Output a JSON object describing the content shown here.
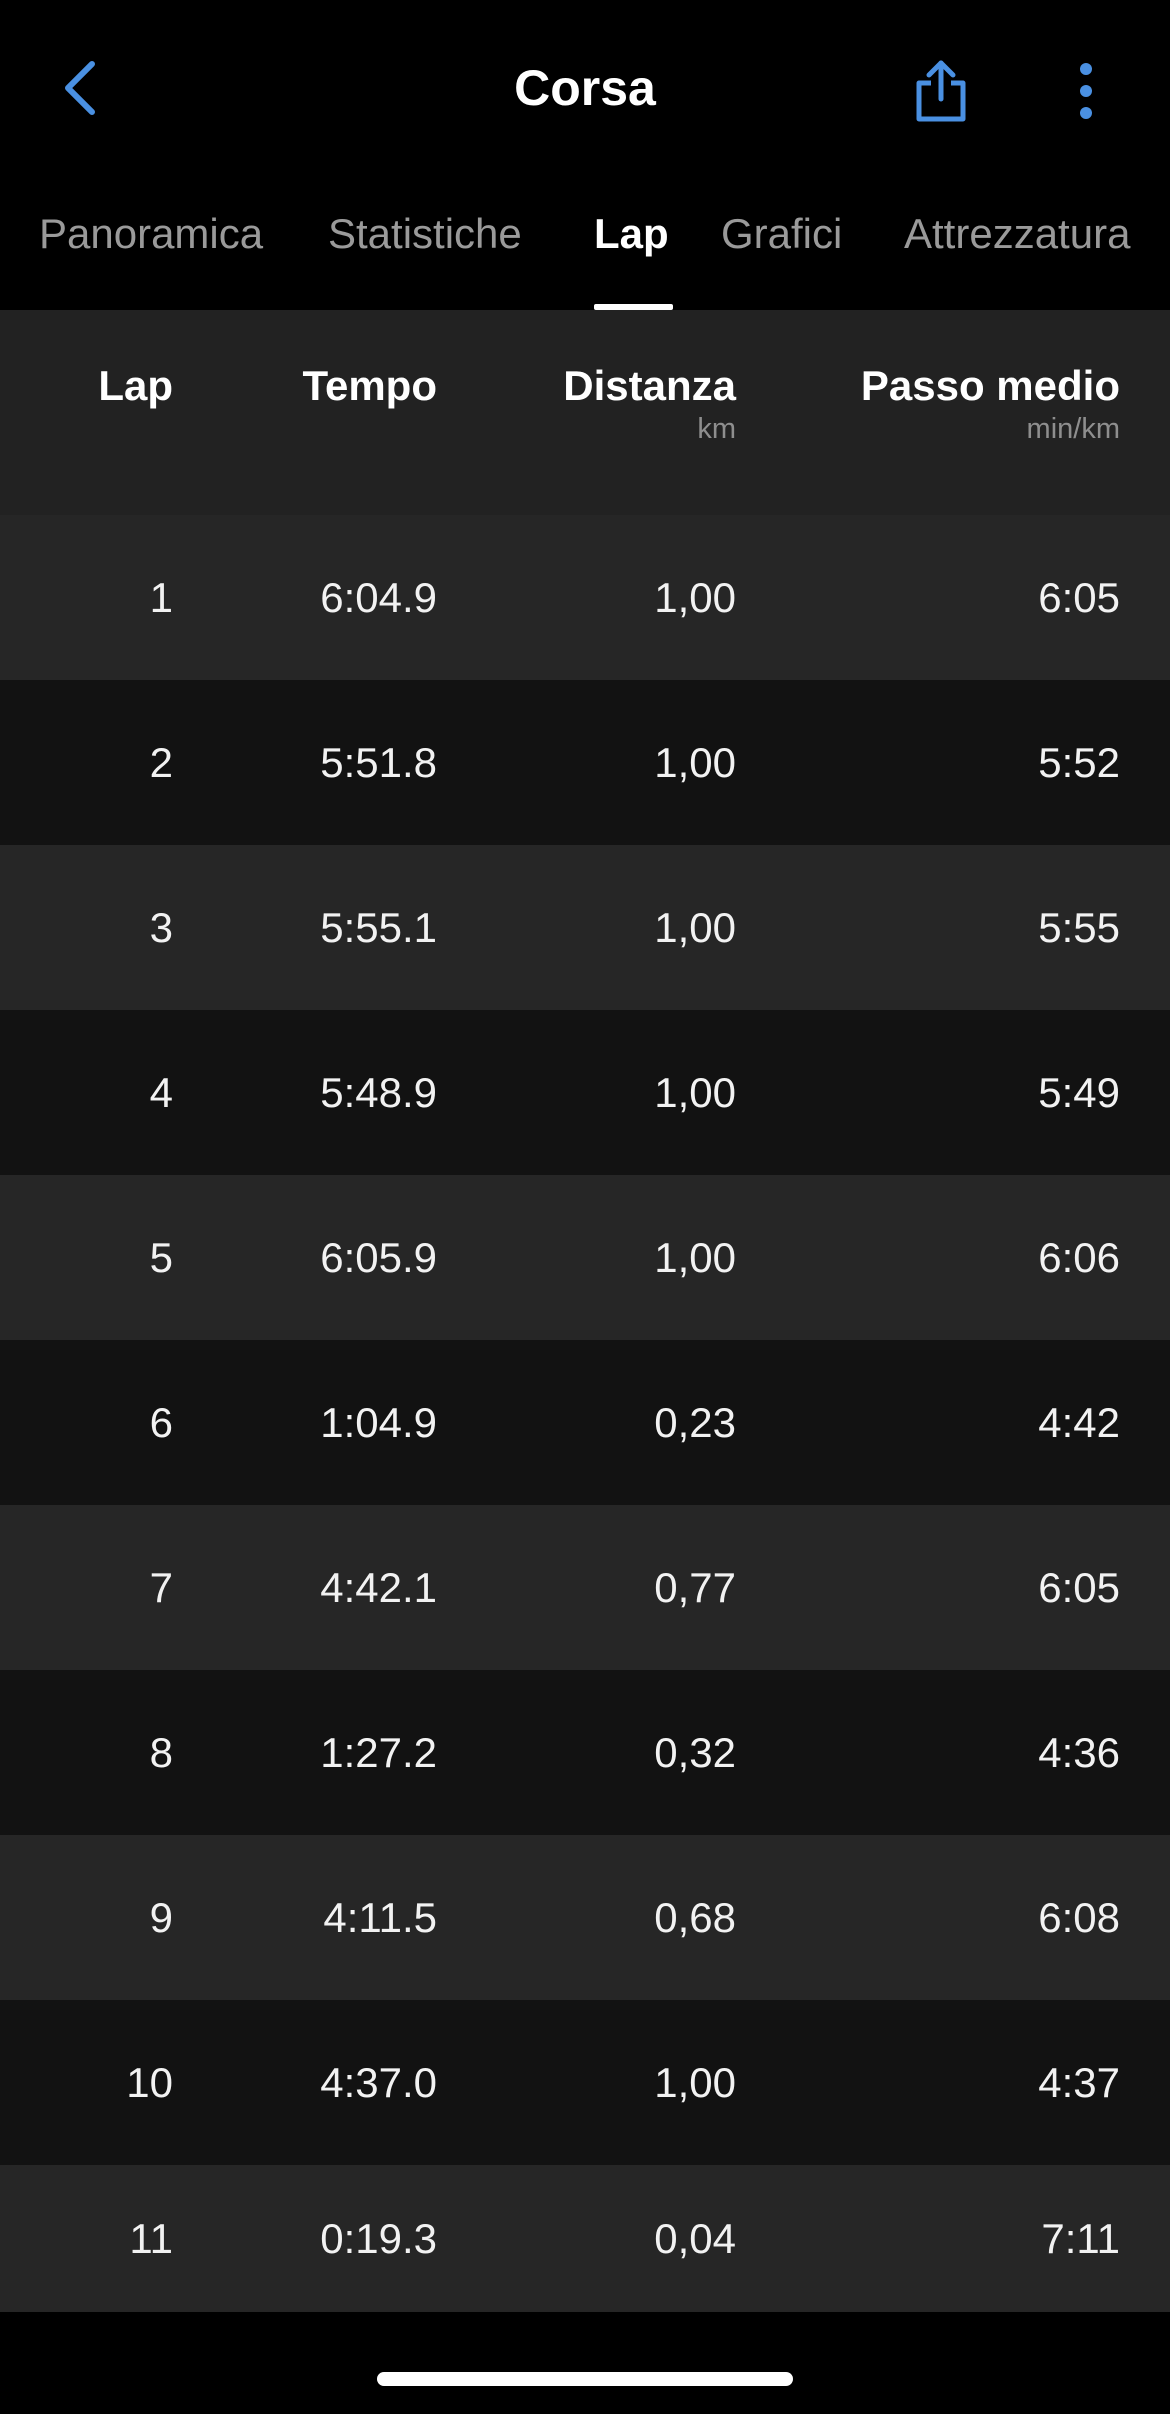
{
  "header": {
    "title": "Corsa",
    "back_icon": "chevron-left-icon",
    "share_icon": "share-icon",
    "more_icon": "more-vertical-icon",
    "accent_color": "#4a90e2"
  },
  "tabs": [
    {
      "label": "Panoramica",
      "active": false
    },
    {
      "label": "Statistiche",
      "active": false
    },
    {
      "label": "Lap",
      "active": true
    },
    {
      "label": "Grafici",
      "active": false
    },
    {
      "label": "Attrezzatura",
      "active": false
    }
  ],
  "table": {
    "columns": [
      {
        "label": "Lap",
        "unit": ""
      },
      {
        "label": "Tempo",
        "unit": ""
      },
      {
        "label": "Distanza",
        "unit": "km"
      },
      {
        "label": "Passo medio",
        "unit": "min/km"
      }
    ],
    "rows": [
      {
        "lap": "1",
        "tempo": "6:04.9",
        "distanza": "1,00",
        "passo": "6:05"
      },
      {
        "lap": "2",
        "tempo": "5:51.8",
        "distanza": "1,00",
        "passo": "5:52"
      },
      {
        "lap": "3",
        "tempo": "5:55.1",
        "distanza": "1,00",
        "passo": "5:55"
      },
      {
        "lap": "4",
        "tempo": "5:48.9",
        "distanza": "1,00",
        "passo": "5:49"
      },
      {
        "lap": "5",
        "tempo": "6:05.9",
        "distanza": "1,00",
        "passo": "6:06"
      },
      {
        "lap": "6",
        "tempo": "1:04.9",
        "distanza": "0,23",
        "passo": "4:42"
      },
      {
        "lap": "7",
        "tempo": "4:42.1",
        "distanza": "0,77",
        "passo": "6:05"
      },
      {
        "lap": "8",
        "tempo": "1:27.2",
        "distanza": "0,32",
        "passo": "4:36"
      },
      {
        "lap": "9",
        "tempo": "4:11.5",
        "distanza": "0,68",
        "passo": "6:08"
      },
      {
        "lap": "10",
        "tempo": "4:37.0",
        "distanza": "1,00",
        "passo": "4:37"
      },
      {
        "lap": "11",
        "tempo": "0:19.3",
        "distanza": "0,04",
        "passo": "7:11"
      }
    ]
  }
}
